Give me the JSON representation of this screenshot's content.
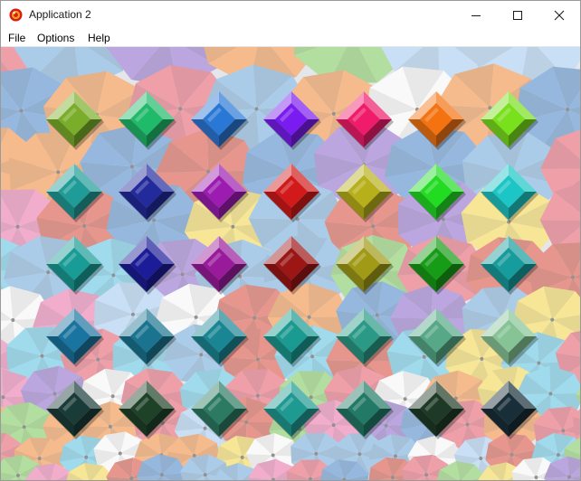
{
  "window": {
    "title": "Application 2",
    "icon": "red-ball-icon",
    "controls": [
      "minimize-icon",
      "maximize-icon",
      "close-icon"
    ]
  },
  "menu": {
    "items": [
      "File",
      "Options",
      "Help"
    ]
  },
  "board": {
    "rows": 5,
    "cols": 7,
    "background": "umbrella-sky-photo",
    "gem_shape": "diamond",
    "gems": [
      [
        "#7aae2a",
        "#1fba6a",
        "#2a78d6",
        "#7a1cf0",
        "#f01b6a",
        "#f47310",
        "#79e01c"
      ],
      [
        "#1f9c98",
        "#232a9c",
        "#9c1cb2",
        "#d21a1a",
        "#b8b01a",
        "#22dc22",
        "#1cc6c6"
      ],
      [
        "#1a9c96",
        "#1c1c98",
        "#9a1a9c",
        "#9c1616",
        "#a09a16",
        "#169c16",
        "#169c9c"
      ],
      [
        "#1a74a0",
        "#1a7490",
        "#1a8694",
        "#1a9a90",
        "#2a9a86",
        "#56a886",
        "#86c496"
      ],
      [
        "#1a3c38",
        "#1e4228",
        "#2c7a62",
        "#1f9a92",
        "#227a66",
        "#1e3a26",
        "#182e38"
      ]
    ]
  }
}
